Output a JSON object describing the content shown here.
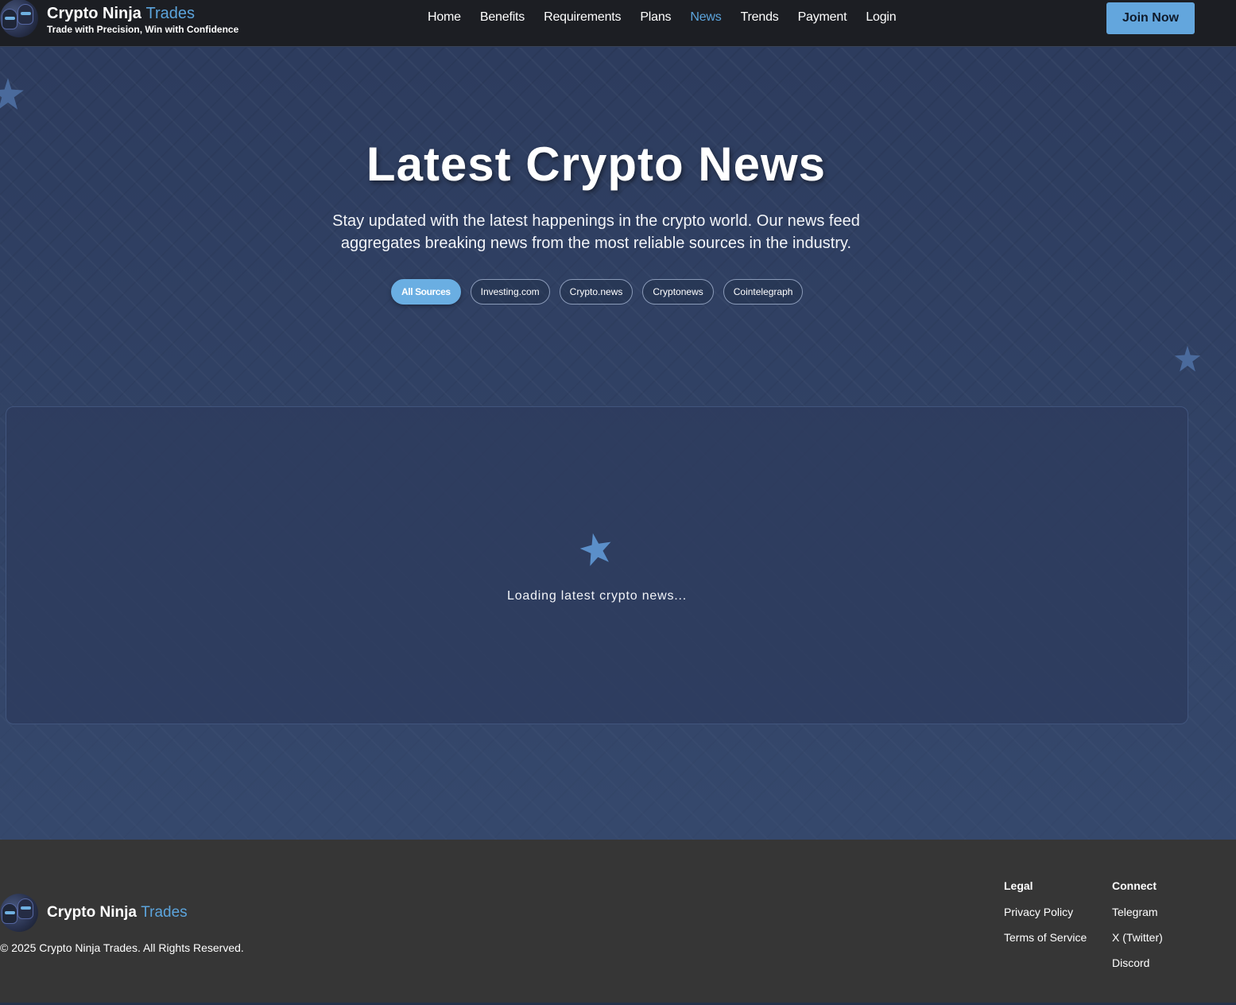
{
  "header": {
    "brand_primary": "Crypto Ninja",
    "brand_accent": "Trades",
    "tagline": "Trade with Precision, Win with Confidence",
    "nav": [
      "Home",
      "Benefits",
      "Requirements",
      "Plans",
      "News",
      "Trends",
      "Payment",
      "Login"
    ],
    "active_nav": "News",
    "join_label": "Join Now"
  },
  "hero": {
    "title": "Latest Crypto News",
    "subtitle": "Stay updated with the latest happenings in the crypto world. Our news feed aggregates breaking news from the most reliable sources in the industry."
  },
  "filters": {
    "items": [
      "All Sources",
      "Investing.com",
      "Crypto.news",
      "Cryptonews",
      "Cointelegraph"
    ],
    "active": "All Sources"
  },
  "news": {
    "loading_text": "Loading latest crypto news..."
  },
  "footer": {
    "brand_primary": "Crypto Ninja",
    "brand_accent": "Trades",
    "copyright": "© 2025 Crypto Ninja Trades. All Rights Reserved.",
    "legal": {
      "heading": "Legal",
      "links": [
        "Privacy Policy",
        "Terms of Service"
      ]
    },
    "connect": {
      "heading": "Connect",
      "links": [
        "Telegram",
        "X (Twitter)",
        "Discord"
      ]
    }
  },
  "colors": {
    "accent": "#5ca4dc",
    "header_bg": "#1c1e23",
    "page_bg": "#2d3c5e",
    "footer_bg": "#363636",
    "join_button": "#63a6dd"
  },
  "icons": {
    "logo": "ninja-logo-icon",
    "decor": "shuriken-star-icon",
    "loader": "shuriken-spinner-icon"
  }
}
